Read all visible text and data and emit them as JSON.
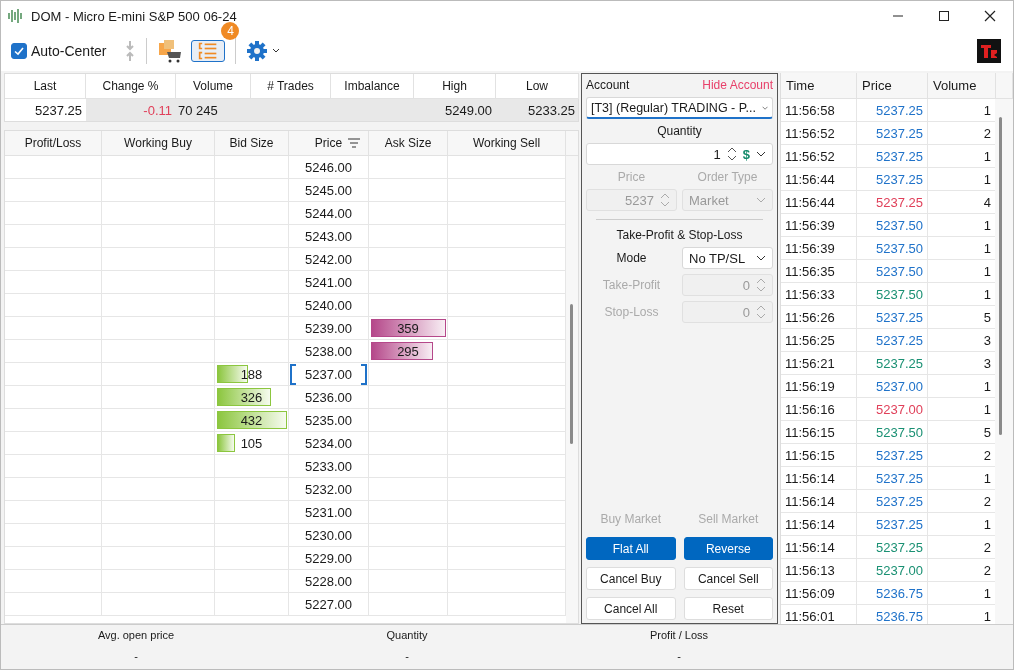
{
  "window": {
    "title": "DOM - Micro E-mini S&P 500 06-24"
  },
  "toolbar": {
    "auto_center": {
      "label": "Auto-Center",
      "checked": true
    },
    "orders_badge": "4",
    "orders_selected": true
  },
  "stats": [
    {
      "label": "Last",
      "value": "5237.25",
      "color": "#1a1a1a"
    },
    {
      "label": "Change %",
      "value": "-0.11",
      "color": "#e0405a"
    },
    {
      "label": "Volume",
      "value": "70 245",
      "color": "#1a1a1a"
    },
    {
      "label": "# Trades"
    },
    {
      "label": "Imbalance"
    },
    {
      "label": "High",
      "value": "5249.00",
      "color": "#1a1a1a"
    },
    {
      "label": "Low",
      "value": "5233.25",
      "color": "#1a1a1a"
    }
  ],
  "dom": {
    "columns": [
      "Profit/Loss",
      "Working Buy",
      "Bid Size",
      "Price",
      "Ask Size",
      "Working Sell"
    ],
    "rows": [
      {
        "price": "5246.00",
        "current": false
      },
      {
        "price": "5245.00",
        "current": false
      },
      {
        "price": "5244.00",
        "current": false
      },
      {
        "price": "5243.00",
        "current": false
      },
      {
        "price": "5242.00",
        "current": false
      },
      {
        "price": "5241.00",
        "current": false
      },
      {
        "price": "5240.00",
        "current": false
      },
      {
        "price": "5239.00",
        "current": false,
        "ask": {
          "size": "359",
          "level": 0.96
        }
      },
      {
        "price": "5238.00",
        "current": false,
        "ask": {
          "size": "295",
          "level": 0.8
        }
      },
      {
        "price": "5237.00",
        "current": true,
        "bid": {
          "size": "188",
          "level": 0.42
        }
      },
      {
        "price": "5236.00",
        "current": false,
        "bid": {
          "size": "326",
          "level": 0.74
        }
      },
      {
        "price": "5235.00",
        "current": false,
        "bid": {
          "size": "432",
          "level": 0.96
        }
      },
      {
        "price": "5234.00",
        "current": false,
        "bid": {
          "size": "105",
          "level": 0.24
        }
      },
      {
        "price": "5233.00",
        "current": false
      },
      {
        "price": "5232.00",
        "current": false
      },
      {
        "price": "5231.00",
        "current": false
      },
      {
        "price": "5230.00",
        "current": false
      },
      {
        "price": "5229.00",
        "current": false
      },
      {
        "price": "5228.00",
        "current": false
      },
      {
        "price": "5227.00",
        "current": false
      }
    ]
  },
  "order_panel": {
    "account_label": "Account",
    "hide_account": "Hide Account",
    "account": "[T3] (Regular) TRADING - P...",
    "quantity_label": "Quantity",
    "quantity": "1",
    "currency_symbol": "$",
    "price_label": "Price",
    "order_type_label": "Order Type",
    "price": "5237",
    "order_type": "Market",
    "price_disabled": true,
    "tp_sl_title": "Take-Profit & Stop-Loss",
    "mode_label": "Mode",
    "mode": "No TP/SL",
    "take_profit_label": "Take-Profit",
    "take_profit": "0",
    "stop_loss_label": "Stop-Loss",
    "stop_loss": "0",
    "tp_sl_disabled": true,
    "buttons": [
      {
        "label": "Buy Market",
        "kind": "text",
        "disabled": true
      },
      {
        "label": "Sell Market",
        "kind": "text",
        "disabled": true
      },
      {
        "label": "Flat All",
        "kind": "primary",
        "disabled": false
      },
      {
        "label": "Reverse",
        "kind": "primary",
        "disabled": false
      },
      {
        "label": "Cancel Buy",
        "kind": "default",
        "disabled": false
      },
      {
        "label": "Cancel Sell",
        "kind": "default",
        "disabled": false
      },
      {
        "label": "Cancel All",
        "kind": "default",
        "disabled": false
      },
      {
        "label": "Reset",
        "kind": "default",
        "disabled": false
      }
    ]
  },
  "time_and_sales": {
    "columns": [
      "Time",
      "Price",
      "Volume"
    ],
    "rows": [
      {
        "time": "11:56:58",
        "price": "5237.25",
        "volume": "1",
        "color": "#1f72c9"
      },
      {
        "time": "11:56:52",
        "price": "5237.25",
        "volume": "2",
        "color": "#1f72c9"
      },
      {
        "time": "11:56:52",
        "price": "5237.25",
        "volume": "1",
        "color": "#1f72c9"
      },
      {
        "time": "11:56:44",
        "price": "5237.25",
        "volume": "1",
        "color": "#1f72c9"
      },
      {
        "time": "11:56:44",
        "price": "5237.25",
        "volume": "4",
        "color": "#e0405a"
      },
      {
        "time": "11:56:39",
        "price": "5237.50",
        "volume": "1",
        "color": "#1f72c9"
      },
      {
        "time": "11:56:39",
        "price": "5237.50",
        "volume": "1",
        "color": "#1f72c9"
      },
      {
        "time": "11:56:35",
        "price": "5237.50",
        "volume": "1",
        "color": "#1f72c9"
      },
      {
        "time": "11:56:33",
        "price": "5237.50",
        "volume": "1",
        "color": "#1a9073"
      },
      {
        "time": "11:56:26",
        "price": "5237.25",
        "volume": "5",
        "color": "#1f72c9"
      },
      {
        "time": "11:56:25",
        "price": "5237.25",
        "volume": "3",
        "color": "#1f72c9"
      },
      {
        "time": "11:56:21",
        "price": "5237.25",
        "volume": "3",
        "color": "#1a9073"
      },
      {
        "time": "11:56:19",
        "price": "5237.00",
        "volume": "1",
        "color": "#1f72c9"
      },
      {
        "time": "11:56:16",
        "price": "5237.00",
        "volume": "1",
        "color": "#e0405a"
      },
      {
        "time": "11:56:15",
        "price": "5237.50",
        "volume": "5",
        "color": "#1a9073"
      },
      {
        "time": "11:56:15",
        "price": "5237.25",
        "volume": "2",
        "color": "#1f72c9"
      },
      {
        "time": "11:56:14",
        "price": "5237.25",
        "volume": "1",
        "color": "#1f72c9"
      },
      {
        "time": "11:56:14",
        "price": "5237.25",
        "volume": "2",
        "color": "#1f72c9"
      },
      {
        "time": "11:56:14",
        "price": "5237.25",
        "volume": "1",
        "color": "#1f72c9"
      },
      {
        "time": "11:56:14",
        "price": "5237.25",
        "volume": "2",
        "color": "#1a9073"
      },
      {
        "time": "11:56:13",
        "price": "5237.00",
        "volume": "2",
        "color": "#1a9073"
      },
      {
        "time": "11:56:09",
        "price": "5236.75",
        "volume": "1",
        "color": "#1f72c9"
      },
      {
        "time": "11:56:01",
        "price": "5236.75",
        "volume": "1",
        "color": "#1f72c9"
      }
    ]
  },
  "summary": [
    {
      "label": "Avg. open price",
      "value": "-"
    },
    {
      "label": "Quantity",
      "value": "-"
    },
    {
      "label": "Profit / Loss",
      "value": "-"
    }
  ]
}
